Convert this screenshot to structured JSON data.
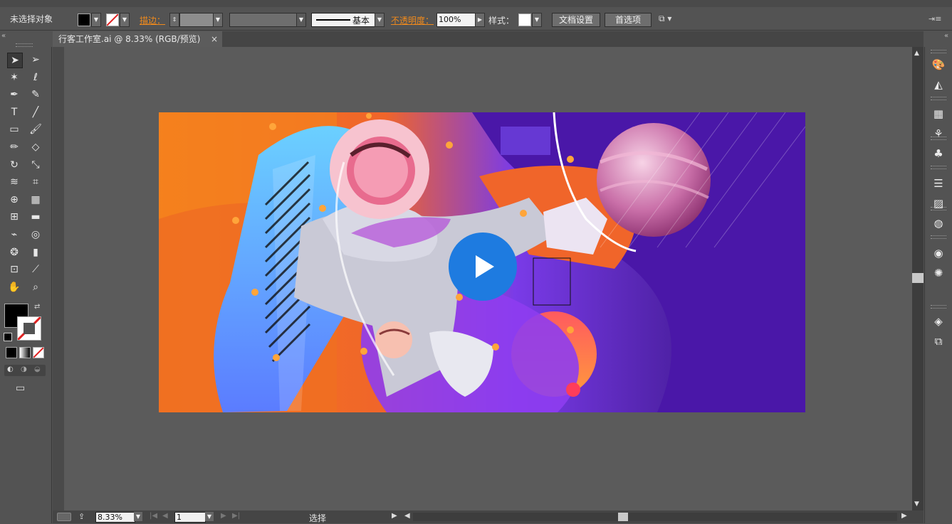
{
  "control_bar": {
    "selection_status": "未选择对象",
    "stroke_label": "描边：",
    "stroke_profile": "基本",
    "opacity_label": "不透明度：",
    "opacity_value": "100%",
    "style_label": "样式：",
    "doc_settings_button": "文档设置",
    "preferences_button": "首选项"
  },
  "document_tab": {
    "title": "行客工作室.ai @ 8.33% (RGB/预览)",
    "close_glyph": "×"
  },
  "status_bar": {
    "zoom_value": "8.33%",
    "artboard_number": "1",
    "current_tool": "选择"
  },
  "colors": {
    "ui_background": "#535353",
    "canvas_background": "#5b5b5b",
    "accent_orange": "#f08a1c",
    "play_button_blue": "#1e7be0"
  },
  "tools": [
    "selection-tool-icon",
    "direct-selection-tool-icon",
    "magic-wand-tool-icon",
    "lasso-tool-icon",
    "pen-tool-icon",
    "curvature-tool-icon",
    "type-tool-icon",
    "line-segment-tool-icon",
    "rectangle-tool-icon",
    "paintbrush-tool-icon",
    "pencil-tool-icon",
    "eraser-tool-icon",
    "rotate-tool-icon",
    "scale-tool-icon",
    "width-tool-icon",
    "free-transform-tool-icon",
    "shape-builder-tool-icon",
    "perspective-grid-tool-icon",
    "mesh-tool-icon",
    "gradient-tool-icon",
    "eyedropper-tool-icon",
    "blend-tool-icon",
    "symbol-sprayer-tool-icon",
    "column-graph-tool-icon",
    "artboard-tool-icon",
    "slice-tool-icon",
    "hand-tool-icon",
    "zoom-tool-icon"
  ],
  "right_panels": [
    "color-panel-icon",
    "color-guide-icon",
    "swatches-icon",
    "brushes-icon",
    "symbols-icon",
    "stroke-panel-icon",
    "gradient-panel-icon",
    "transparency-panel-icon",
    "appearance-panel-icon",
    "graphic-styles-icon",
    "layers-icon",
    "artboards-icon"
  ]
}
